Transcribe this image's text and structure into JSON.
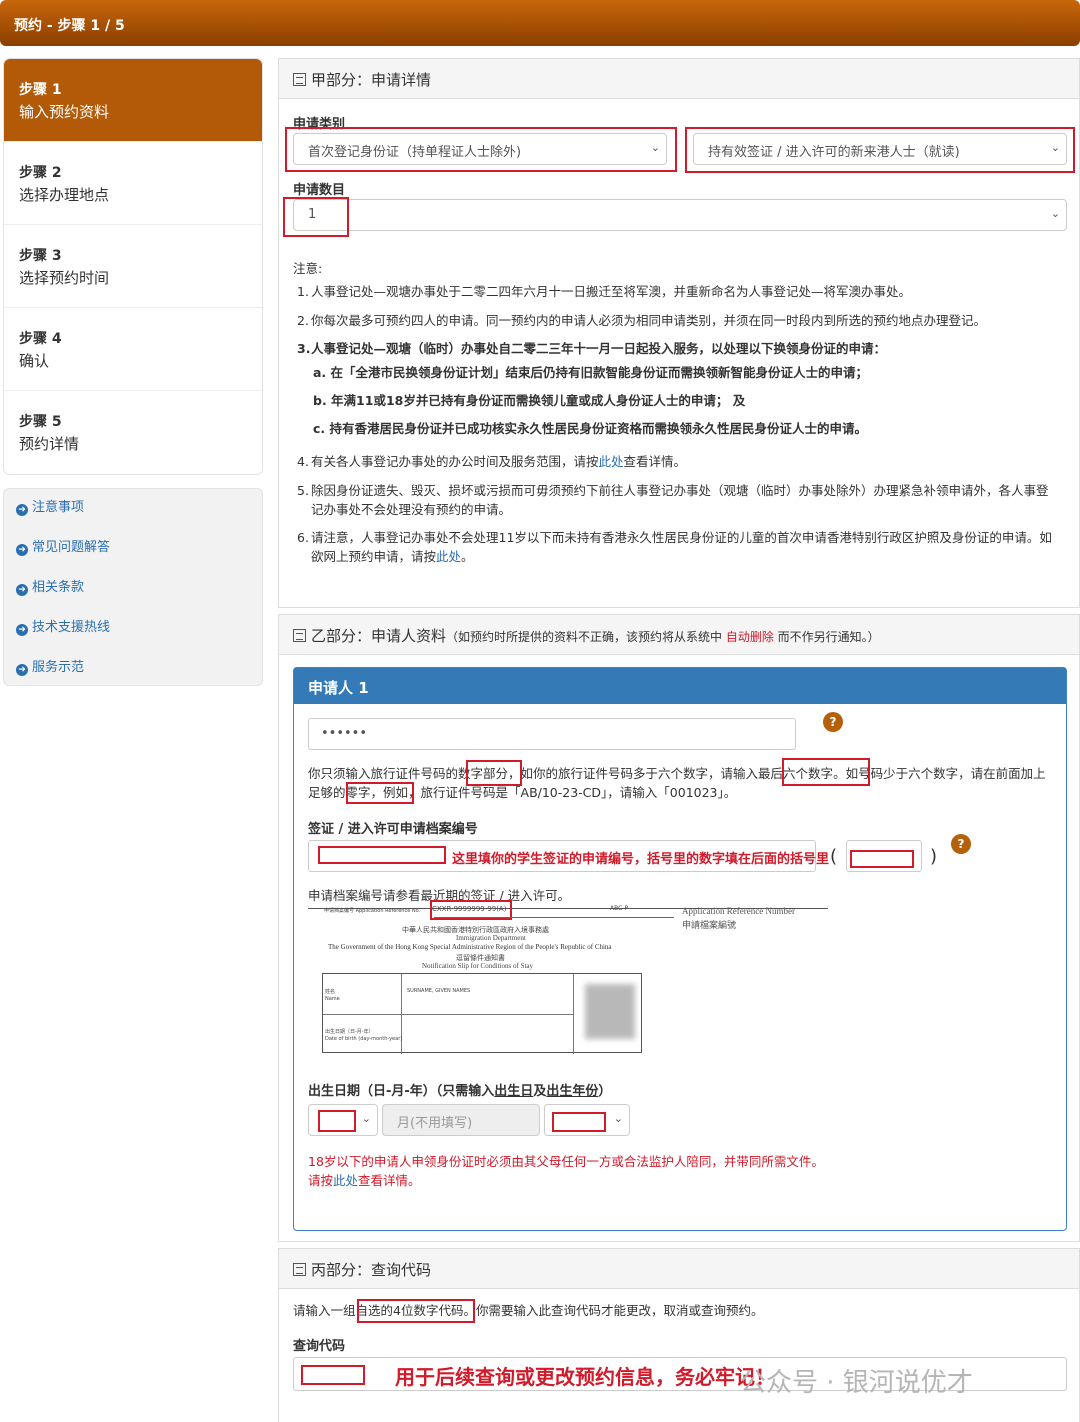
{
  "header": {
    "title": "预约 - 步骤 1 / 5"
  },
  "steps": [
    {
      "num": "步骤 1",
      "label": "输入预约资料"
    },
    {
      "num": "步骤 2",
      "label": "选择办理地点"
    },
    {
      "num": "步骤 3",
      "label": "选择预约时间"
    },
    {
      "num": "步骤 4",
      "label": "确认"
    },
    {
      "num": "步骤 5",
      "label": "预约详情"
    }
  ],
  "links": [
    "注意事项",
    "常见问题解答",
    "相关条款",
    "技术支援热线",
    "服务示范"
  ],
  "partA": {
    "title": "甲部分：申请详情",
    "type_label": "申请类别",
    "type_value": "首次登记身份证（持单程证人士除外)",
    "type2_value": "持有效签证 / 进入许可的新来港人士（就读)",
    "count_label": "申请数目",
    "count_value": "1",
    "notes_title": "注意:",
    "n1": "人事登记处—观塘办事处于二零二四年六月十一日搬迁至将军澳，并重新命名为人事登记处—将军澳办事处。",
    "n2": "你每次最多可预约四人的申请。同一预约内的申请人必须为相同申请类别，并须在同一时段内到所选的预约地点办理登记。",
    "n3": "人事登记处—观塘（临时）办事处自二零二三年十一月一日起投入服务，以处理以下换领身份证的申请：",
    "n3a": "a. 在「全港市民换领身份证计划」结束后仍持有旧款智能身份证而需换领新智能身份证人士的申请；",
    "n3b": "b. 年满11或18岁并已持有身份证而需换领儿童或成人身份证人士的申请； 及",
    "n3c": "c. 持有香港居民身份证并已成功核实永久性居民身份证资格而需换领永久性居民身份证人士的申请。",
    "n4a": "有关各人事登记办事处的办公时间及服务范围，请按",
    "n4link": "此处",
    "n4b": "查看详情。",
    "n5": "除因身份证遗失、毁灭、损坏或污损而可毋须预约下前往人事登记办事处（观塘（临时）办事处除外）办理紧急补领申请外，各人事登记办事处不会处理没有预约的申请。",
    "n6a": "请注意，人事登记办事处不会处理11岁以下而未持有香港永久性居民身份证的儿童的首次申请香港特别行政区护照及身份证的申请。如欲网上预约申请，请按",
    "n6link": "此处",
    "n6b": "。"
  },
  "partB": {
    "title": "乙部分：申请人资料",
    "note_a": "（如预约时所提供的资料不正确，该预约将从系统中 ",
    "note_red": "自动删除",
    "note_b": " 而不作另行通知。）",
    "applicant": "申请人 1",
    "doc_value": "••••••",
    "doc_hint_1": "你只须输入旅行证件号码的",
    "doc_hint_2": "数字部分",
    "doc_hint_3": "，如你的旅行证件号码多于六个数字，请输入",
    "doc_hint_4": "最后六个数字",
    "doc_hint_5": "。如号码少于六个数字，请在前面加上",
    "doc_hint_6": "足够的零字",
    "doc_hint_7": "，例如，旅行证件号码是「AB/10-23-CD」，请输入「001023」。",
    "visa_label": "签证 / 进入许可申请档案编号",
    "visa_annotation": "这里填你的学生签证的申请编号，括号里的数字填在后面的括号里",
    "visa_ref_hint": "申请档案编号请参看最近期的签证 / 进入许可。",
    "dob_label_a": "出生日期（日-月-年）（只需输入",
    "dob_label_u1": "出生日",
    "dob_label_b": "及",
    "dob_label_u2": "出生年份",
    "dob_label_c": "）",
    "month_placeholder": "月(不用填写)",
    "warn1": "18岁以下的申请人申领身份证时必须由其父母任何一方或合法监护人陪同，并带同所需文件。",
    "warn2a": "请按",
    "warn2link": "此处",
    "warn2b": "查看详情。",
    "sample": {
      "ref_label": "申请档案编号 Application Reference No.",
      "ref_value": "CXXR-9999999-99(A)",
      "abc": "ABC-P",
      "ref_en": "Application Reference Number",
      "ref_cn": "申請檔案編號",
      "dept_cn": "中華人民共和國香港特別行政區政府入境事務處",
      "dept_en": "Immigration Department",
      "gov": "The Government of the Hong Kong Special Administrative Region of the People's Republic of China",
      "slip_cn": "逗留條件通知書",
      "slip_en": "Notification Slip for Conditions of Stay",
      "name_cn": "姓名",
      "name_en": "Name",
      "surname": "SURNAME, GIVEN NAMES",
      "dob_cn": "出生日期（日-月-年）",
      "dob_en": "Date of birth (day-month-year)"
    }
  },
  "partC": {
    "title": "丙部分：查询代码",
    "hint_a": "请输入一组",
    "hint_b": "自选的4位数字代码",
    "hint_c": "。你需要输入此查询代码才能更改，取消或查询预约。",
    "code_label": "查询代码",
    "annotation": "用于后续查询或更改预约信息，务必牢记！"
  },
  "watermark": "公众号 · 银河说优才",
  "colors": {
    "brand": "#b35a08",
    "header_blue": "#337ab7",
    "annotation_red": "#d11a2a",
    "link": "#2a6fb0"
  }
}
